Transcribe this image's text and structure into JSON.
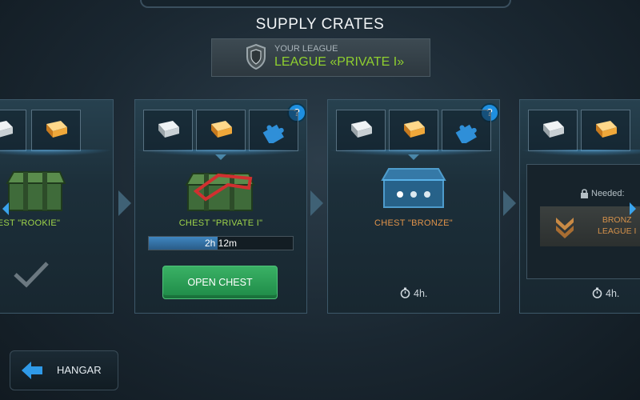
{
  "header": {
    "title": "SUPPLY CRATES",
    "league_caption": "YOUR LEAGUE",
    "league_name": "LEAGUE «PRIVATE I»"
  },
  "cards": [
    {
      "id": "rookie",
      "label": "EST \"ROOKIE\"",
      "status": "claimed"
    },
    {
      "id": "private",
      "label": "CHEST \"PRIVATE I\"",
      "timer_text": "2h 12m",
      "progress": 0.48,
      "button": "OPEN CHEST",
      "help": "?"
    },
    {
      "id": "bronze",
      "label": "CHEST \"BRONZE\"",
      "duration": "4h.",
      "help": "?"
    },
    {
      "id": "locked",
      "needed": "Needed:",
      "league_line1": "BRONZ",
      "league_line2": "LEAGUE I",
      "duration": "4h."
    }
  ],
  "footer": {
    "hangar_label": "HANGAR"
  },
  "colors": {
    "accent_green": "#8fcf2f",
    "button_green": "#2a9e55",
    "highlight_blue": "#1e8fe0",
    "bronze": "#d4914b"
  },
  "icons": [
    "silver-ingot-icon",
    "gold-ingot-icon",
    "puzzle-piece-icon",
    "shield-icon",
    "checkmark-icon",
    "stopwatch-icon",
    "lock-icon",
    "rank-chevron-icon",
    "back-arrow-icon"
  ]
}
